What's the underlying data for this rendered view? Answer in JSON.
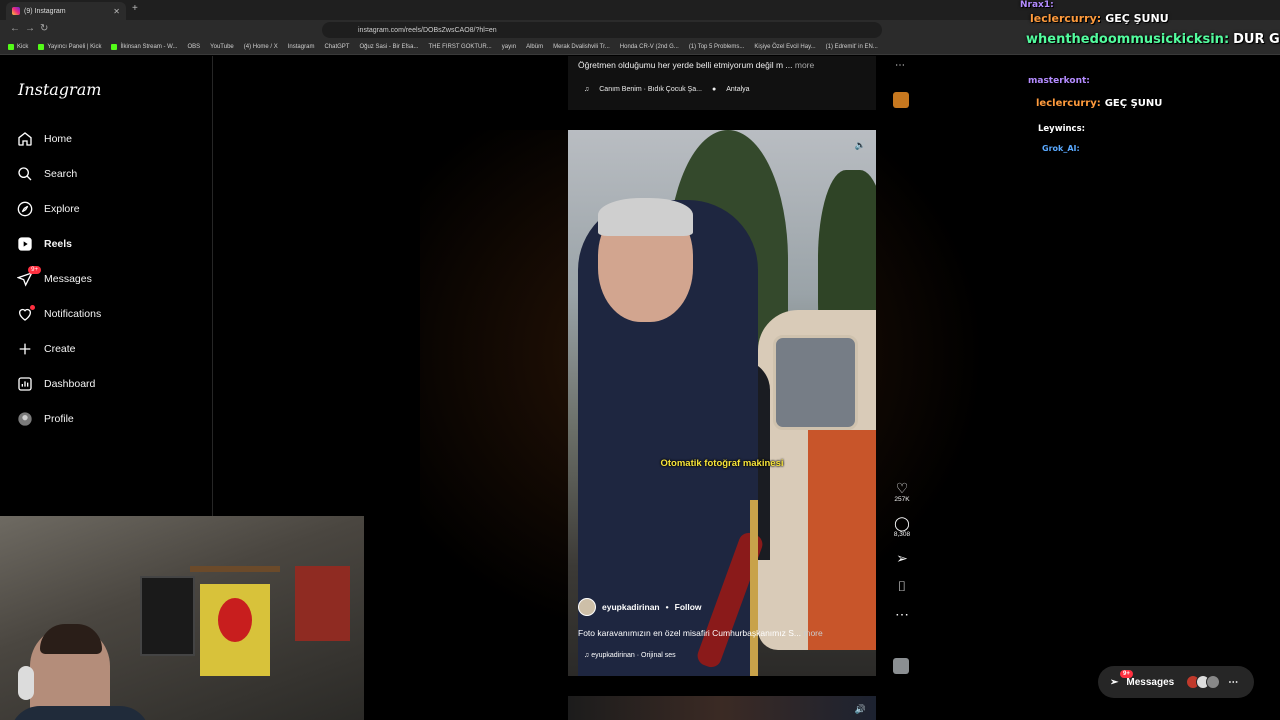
{
  "browser": {
    "tab_title": "(9) Instagram",
    "url": "instagram.com/reels/DOBsZwsCAO8/?hl=en",
    "bookmarks": [
      "Kick",
      "Yayıncı Paneli | Kick",
      "İlkinsan Stream - W...",
      "OBS",
      "YouTube",
      "(4) Home / X",
      "Instagram",
      "ChatGPT",
      "Oğuz Sasi - Bir Efsa...",
      "THE FIRST GOKTUR...",
      "yayın",
      "Albüm",
      "Merak Dvalishvili Tr...",
      "Honda CR-V (2nd G...",
      "(1) Top 5 Problems...",
      "Kişiye Özel Evcil Hay...",
      "(1) Edremit' in EN..."
    ]
  },
  "sidebar": {
    "logo": "Instagram",
    "items": [
      {
        "label": "Home",
        "icon": "home-icon"
      },
      {
        "label": "Search",
        "icon": "search-icon"
      },
      {
        "label": "Explore",
        "icon": "compass-icon"
      },
      {
        "label": "Reels",
        "icon": "reels-icon"
      },
      {
        "label": "Messages",
        "icon": "messenger-icon",
        "badge": "9+"
      },
      {
        "label": "Notifications",
        "icon": "heart-icon"
      },
      {
        "label": "Create",
        "icon": "plus-icon"
      },
      {
        "label": "Dashboard",
        "icon": "dashboard-icon"
      },
      {
        "label": "Profile",
        "icon": "avatar-icon"
      }
    ]
  },
  "prev_reel": {
    "caption": "Öğretmen olduğumu her yerde belli etmiyorum değil m ...",
    "more": "more",
    "audio": "Canım Benim · Bıdık Çocuk Şa...",
    "location": "Antalya"
  },
  "reel": {
    "subtitle": "Otomatik fotoğraf makinesi",
    "author": "eyupkadirinan",
    "follow": "Follow",
    "caption": "Foto karavanımızın en özel misafiri Cumhurbaşkanımız S...",
    "more": "more",
    "audio": "eyupkadirinan · Orijinal ses",
    "likes": "257K",
    "comments": "8,308"
  },
  "chat": [
    {
      "user": "Nrax1:",
      "text": "",
      "color": "#b48cff"
    },
    {
      "user": "leclercurry:",
      "text": "GEÇ ŞUNU",
      "color": "#ff9b3d"
    },
    {
      "user": "whenthedoommusickicksin:",
      "text": "DUR GEÇME",
      "color": "#53fc9e"
    },
    {
      "user": "masterkont:",
      "text": "",
      "color": "#b48cff"
    },
    {
      "user": "leclercurry:",
      "text": "GEÇ ŞUNU",
      "color": "#ff9b3d"
    },
    {
      "user": "Leywincs:",
      "text": "",
      "color": "#ffffff"
    },
    {
      "user": "Grok_AI:",
      "text": "",
      "color": "#5aa9ff"
    }
  ],
  "messages_pill": {
    "label": "Messages",
    "badge": "9+"
  }
}
